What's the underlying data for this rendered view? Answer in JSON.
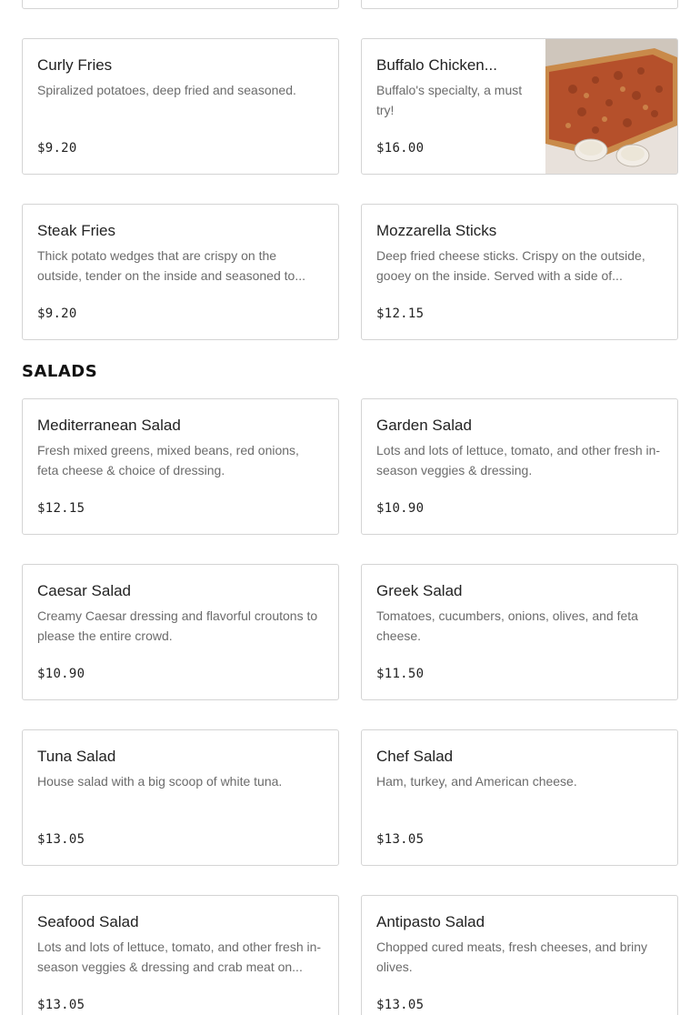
{
  "sections": {
    "appetizers": {
      "items": [
        {
          "title": "Curly Fries",
          "desc": "Spiralized potatoes, deep fried and seasoned.",
          "price": "$9.20"
        },
        {
          "title": "Buffalo Chicken...",
          "desc": "Buffalo's specialty, a must try!",
          "price": "$16.00",
          "image": "pizza-photo"
        },
        {
          "title": "Steak Fries",
          "desc": "Thick potato wedges that are crispy on the outside, tender on the inside and seasoned to...",
          "price": "$9.20"
        },
        {
          "title": "Mozzarella Sticks",
          "desc": "Deep fried cheese sticks. Crispy on the outside, gooey on the inside. Served with a side of...",
          "price": "$12.15"
        }
      ]
    },
    "salads": {
      "title": "SALADS",
      "items": [
        {
          "title": "Mediterranean Salad",
          "desc": "Fresh mixed greens, mixed beans, red onions, feta cheese & choice of dressing.",
          "price": "$12.15"
        },
        {
          "title": "Garden Salad",
          "desc": "Lots and lots of lettuce, tomato, and other fresh in-season veggies & dressing.",
          "price": "$10.90"
        },
        {
          "title": "Caesar Salad",
          "desc": "Creamy Caesar dressing and flavorful croutons to please the entire crowd.",
          "price": "$10.90"
        },
        {
          "title": "Greek Salad",
          "desc": "Tomatoes, cucumbers, onions, olives, and feta cheese.",
          "price": "$11.50"
        },
        {
          "title": "Tuna Salad",
          "desc": "House salad with a big scoop of white tuna.",
          "price": "$13.05"
        },
        {
          "title": "Chef Salad",
          "desc": "Ham, turkey, and American cheese.",
          "price": "$13.05"
        },
        {
          "title": "Seafood Salad",
          "desc": "Lots and lots of lettuce, tomato, and other fresh in-season veggies & dressing and crab meat on...",
          "price": "$13.05"
        },
        {
          "title": "Antipasto Salad",
          "desc": "Chopped cured meats, fresh cheeses, and briny olives.",
          "price": "$13.05"
        }
      ]
    }
  }
}
